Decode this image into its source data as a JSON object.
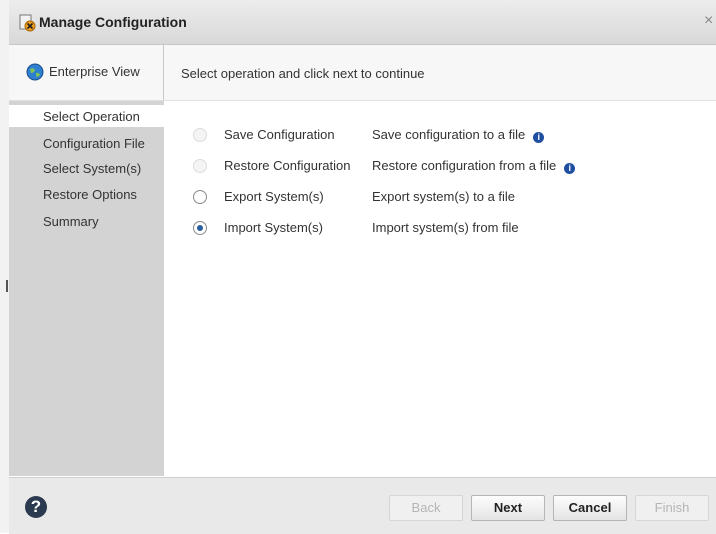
{
  "window": {
    "title": "Manage Configuration",
    "close_glyph": "×"
  },
  "header": {
    "context_label": "Enterprise View",
    "instruction": "Select operation and click next to continue"
  },
  "sidebar": {
    "steps": [
      {
        "label": "Select Operation",
        "active": true
      },
      {
        "label": "Configuration File",
        "active": false
      },
      {
        "label": "Select System(s)",
        "active": false
      },
      {
        "label": "Restore Options",
        "active": false
      },
      {
        "label": "Summary",
        "active": false
      }
    ]
  },
  "operations": [
    {
      "name": "Save Configuration",
      "description": "Save configuration to a file",
      "enabled": false,
      "selected": false,
      "info": "i"
    },
    {
      "name": "Restore Configuration",
      "description": "Restore configuration from a file",
      "enabled": false,
      "selected": false,
      "info": "i"
    },
    {
      "name": "Export System(s)",
      "description": "Export system(s) to a file",
      "enabled": true,
      "selected": false
    },
    {
      "name": "Import System(s)",
      "description": "Import system(s) from file",
      "enabled": true,
      "selected": true
    }
  ],
  "footer": {
    "help_glyph": "?",
    "back_label": "Back",
    "next_label": "Next",
    "cancel_label": "Cancel",
    "finish_label": "Finish"
  },
  "colors": {
    "sidebar_bg": "#d3d3d3",
    "radio_selected": "#2a5d9c",
    "info_icon": "#1f4fa0"
  }
}
